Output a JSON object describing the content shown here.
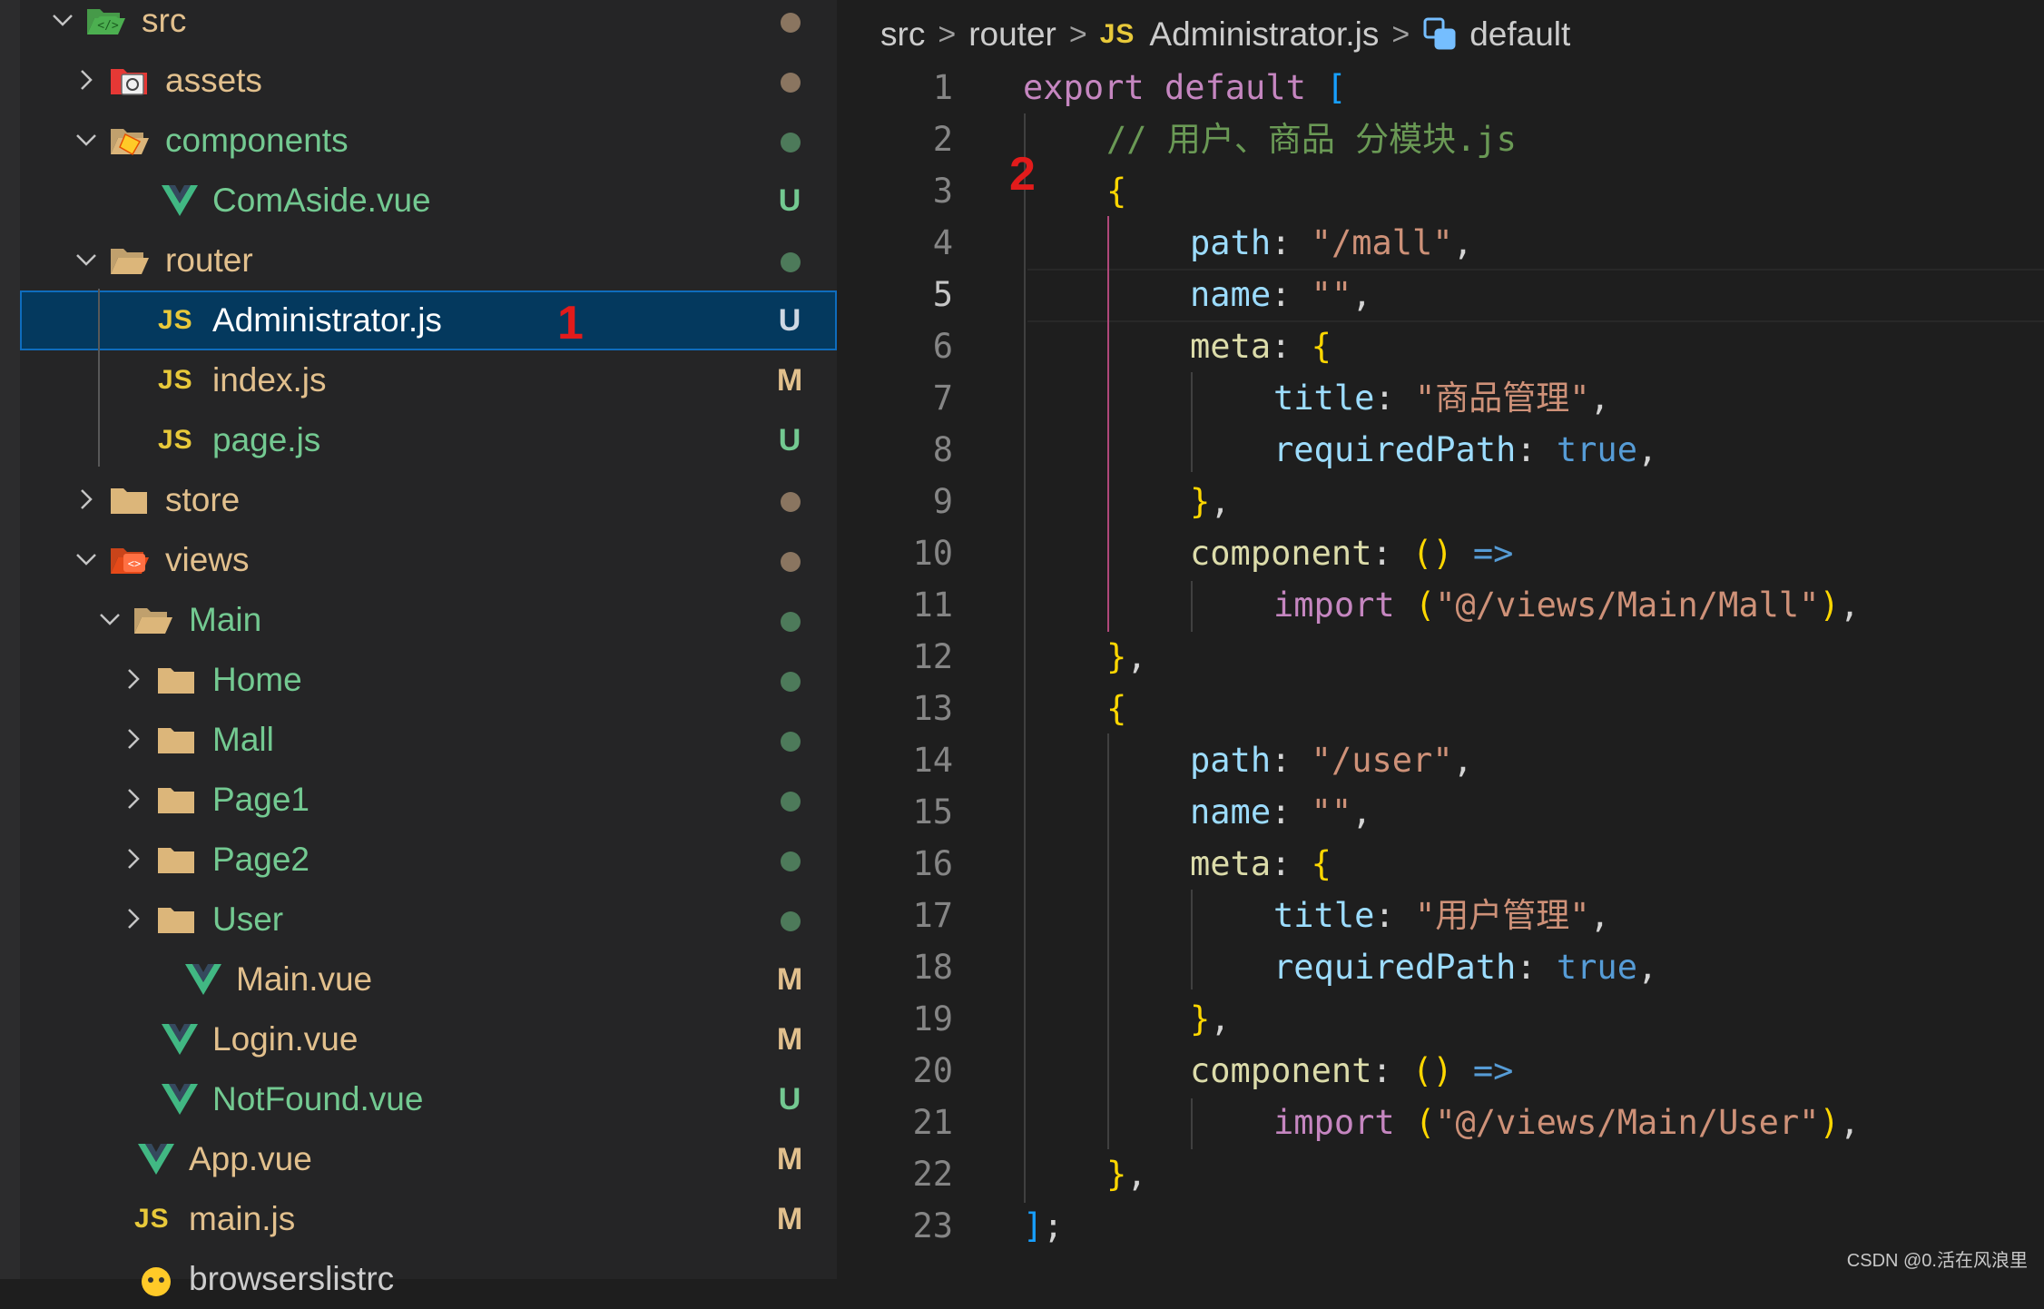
{
  "explorer": {
    "items": [
      {
        "label": "src",
        "status": "dot",
        "kind": "folder-src",
        "expanded": true
      },
      {
        "label": "assets",
        "status": "dot",
        "kind": "folder-assets",
        "expanded": false
      },
      {
        "label": "components",
        "status": "dot",
        "kind": "folder-components",
        "expanded": true
      },
      {
        "label": "ComAside.vue",
        "status": "U",
        "kind": "vue"
      },
      {
        "label": "router",
        "status": "dot",
        "kind": "folder",
        "expanded": true
      },
      {
        "label": "Administrator.js",
        "status": "U",
        "kind": "js",
        "selected": true
      },
      {
        "label": "index.js",
        "status": "M",
        "kind": "js"
      },
      {
        "label": "page.js",
        "status": "U",
        "kind": "js"
      },
      {
        "label": "store",
        "status": "dot",
        "kind": "folder",
        "expanded": false
      },
      {
        "label": "views",
        "status": "dot",
        "kind": "folder-views",
        "expanded": true
      },
      {
        "label": "Main",
        "status": "dot",
        "kind": "folder",
        "expanded": true
      },
      {
        "label": "Home",
        "status": "dot",
        "kind": "folder",
        "expanded": false
      },
      {
        "label": "Mall",
        "status": "dot",
        "kind": "folder",
        "expanded": false
      },
      {
        "label": "Page1",
        "status": "dot",
        "kind": "folder",
        "expanded": false
      },
      {
        "label": "Page2",
        "status": "dot",
        "kind": "folder",
        "expanded": false
      },
      {
        "label": "User",
        "status": "dot",
        "kind": "folder",
        "expanded": false
      },
      {
        "label": "Main.vue",
        "status": "M",
        "kind": "vue"
      },
      {
        "label": "Login.vue",
        "status": "M",
        "kind": "vue"
      },
      {
        "label": "NotFound.vue",
        "status": "U",
        "kind": "vue"
      },
      {
        "label": "App.vue",
        "status": "M",
        "kind": "vue"
      },
      {
        "label": "main.js",
        "status": "M",
        "kind": "js"
      },
      {
        "label": "browserslistrc",
        "status": "",
        "kind": "file-browsers"
      }
    ],
    "js_badge": "JS"
  },
  "annotations": {
    "one": "1",
    "two": "2"
  },
  "breadcrumb": {
    "parts": [
      "src",
      "router",
      "Administrator.js",
      "default"
    ],
    "js_badge": "JS"
  },
  "editor": {
    "active_line": 5,
    "lines": [
      "export default [",
      "  // 用户、商品 分模块.js",
      "  {",
      "    path: \"/mall\",",
      "    name: \"\",",
      "    meta: {",
      "      title: \"商品管理\",",
      "      requiredPath: true,",
      "    },",
      "    component: () =>",
      "      import (\"@/views/Main/Mall\"),",
      "  },",
      "  {",
      "    path: \"/user\",",
      "    name: \"\",",
      "    meta: {",
      "      title: \"用户管理\",",
      "      requiredPath: true,",
      "    },",
      "    component: () =>",
      "      import (\"@/views/Main/User\"),",
      "  },",
      "];"
    ]
  },
  "watermark": "CSDN @0.活在风浪里",
  "colors": {
    "modified": "#e2c08d",
    "untracked": "#73c991",
    "selection": "#04395e"
  }
}
